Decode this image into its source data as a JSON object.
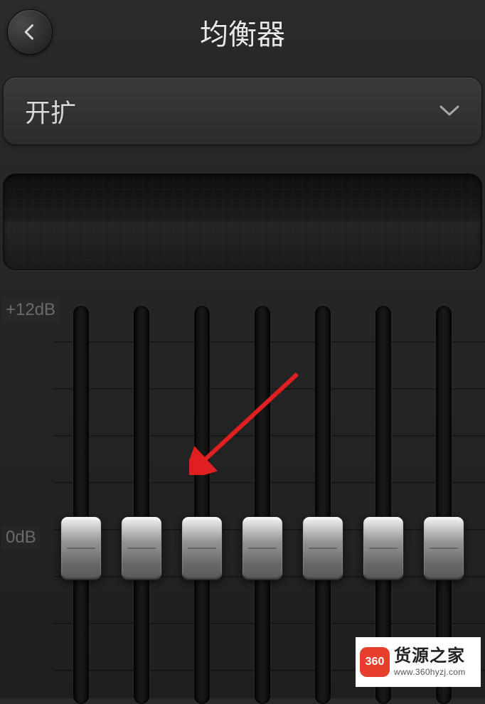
{
  "header": {
    "title": "均衡器"
  },
  "preset": {
    "selected": "开扩"
  },
  "eq": {
    "label_top": "+12dB",
    "label_mid": "0dB",
    "slider_positions": [
      296,
      296,
      296,
      296,
      296,
      296,
      296
    ],
    "grid_rows": [
      50,
      116,
      182,
      248,
      314,
      380,
      446,
      512
    ]
  },
  "watermark": {
    "logo_text": "360",
    "line1": "货源之家",
    "line2": "www.360hyzj.com"
  },
  "colors": {
    "arrow": "#e02020"
  }
}
